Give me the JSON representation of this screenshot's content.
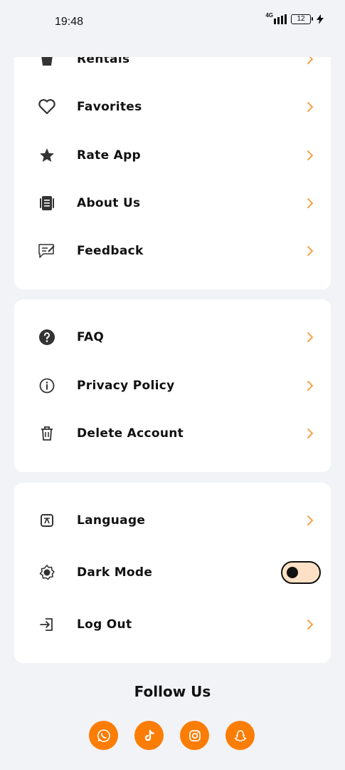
{
  "status": {
    "time": "19:48",
    "network": "4G",
    "battery": "12"
  },
  "colors": {
    "accent": "#f7a44a",
    "social_bg": "#fb7d05",
    "toggle_bg": "#fde0c5",
    "icon": "#333333"
  },
  "menu_group_1": [
    {
      "label": "Rentals",
      "icon": "bag-icon"
    },
    {
      "label": "Favorites",
      "icon": "heart-icon"
    },
    {
      "label": "Rate App",
      "icon": "star-icon"
    },
    {
      "label": "About Us",
      "icon": "book-icon"
    },
    {
      "label": "Feedback",
      "icon": "feedback-icon"
    }
  ],
  "menu_group_2": [
    {
      "label": "FAQ",
      "icon": "question-icon"
    },
    {
      "label": "Privacy Policy",
      "icon": "info-icon"
    },
    {
      "label": "Delete Account",
      "icon": "trash-icon"
    }
  ],
  "menu_group_3": [
    {
      "label": "Language",
      "icon": "translate-icon"
    },
    {
      "label": "Dark Mode",
      "icon": "brightness-icon",
      "toggle": false
    },
    {
      "label": "Log Out",
      "icon": "logout-icon"
    }
  ],
  "follow": {
    "title": "Follow Us",
    "socials": [
      "whatsapp-icon",
      "tiktok-icon",
      "instagram-icon",
      "snapchat-icon"
    ]
  }
}
